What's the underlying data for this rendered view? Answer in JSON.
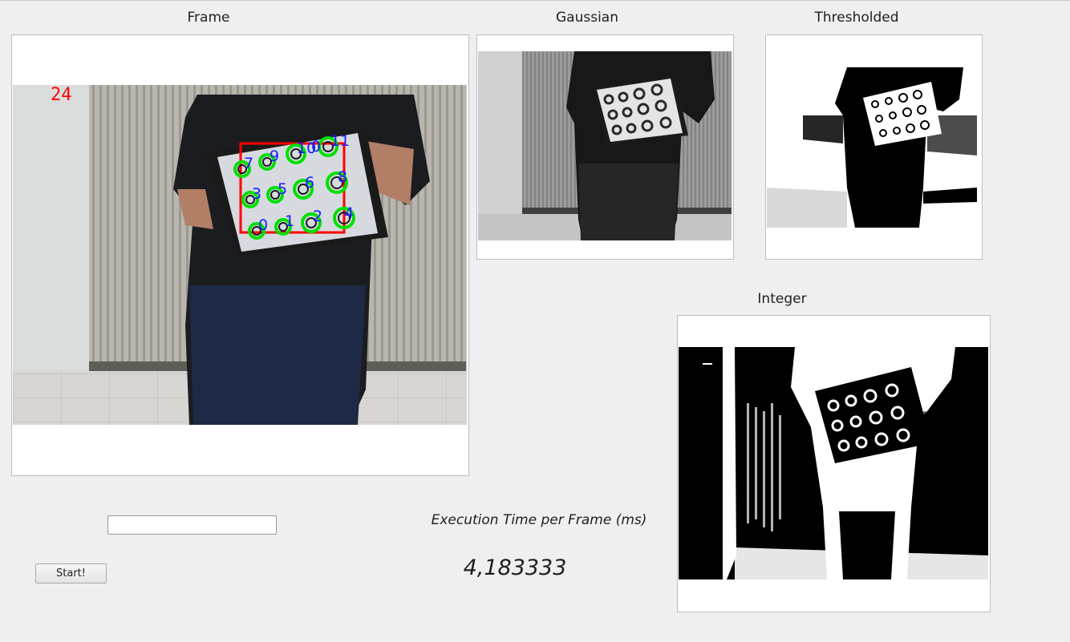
{
  "panels": {
    "frame": {
      "title": "Frame",
      "overlay_count": "24"
    },
    "gaussian": {
      "title": "Gaussian"
    },
    "thresholded": {
      "title": "Thresholded"
    },
    "integer": {
      "title": "Integer"
    }
  },
  "marker_labels": [
    "7",
    "9",
    "10",
    "0",
    "11",
    "3",
    "5",
    "6",
    "8",
    "0",
    "1",
    "2",
    "4"
  ],
  "controls": {
    "input_value": "",
    "start_label": "Start!"
  },
  "stats": {
    "exec_label": "Execution Time per Frame (ms)",
    "exec_value": "4,183333"
  },
  "colors": {
    "window_bg": "#efefef",
    "overlay_red": "#ff0000",
    "marker_green": "#00ff00",
    "label_blue": "#1a1aff"
  }
}
